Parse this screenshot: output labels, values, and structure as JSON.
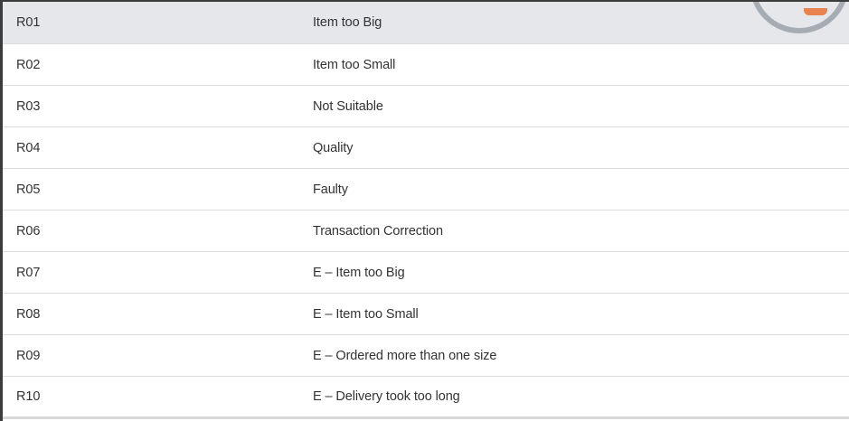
{
  "table": {
    "rows": [
      {
        "code": "R01",
        "description": "Item too Big"
      },
      {
        "code": "R02",
        "description": "Item too Small"
      },
      {
        "code": "R03",
        "description": "Not Suitable"
      },
      {
        "code": "R04",
        "description": "Quality"
      },
      {
        "code": "R05",
        "description": "Faulty"
      },
      {
        "code": "R06",
        "description": "Transaction Correction"
      },
      {
        "code": "R07",
        "description": "E – Item too Big"
      },
      {
        "code": "R08",
        "description": "E – Item too Small"
      },
      {
        "code": "R09",
        "description": "E – Ordered more than one size"
      },
      {
        "code": "R10",
        "description": "E – Delivery took too long"
      }
    ]
  },
  "colors": {
    "selected_row": "#e6e7eb",
    "avatar_ring": "#a6acb3",
    "avatar_accent": "#e8834f"
  }
}
